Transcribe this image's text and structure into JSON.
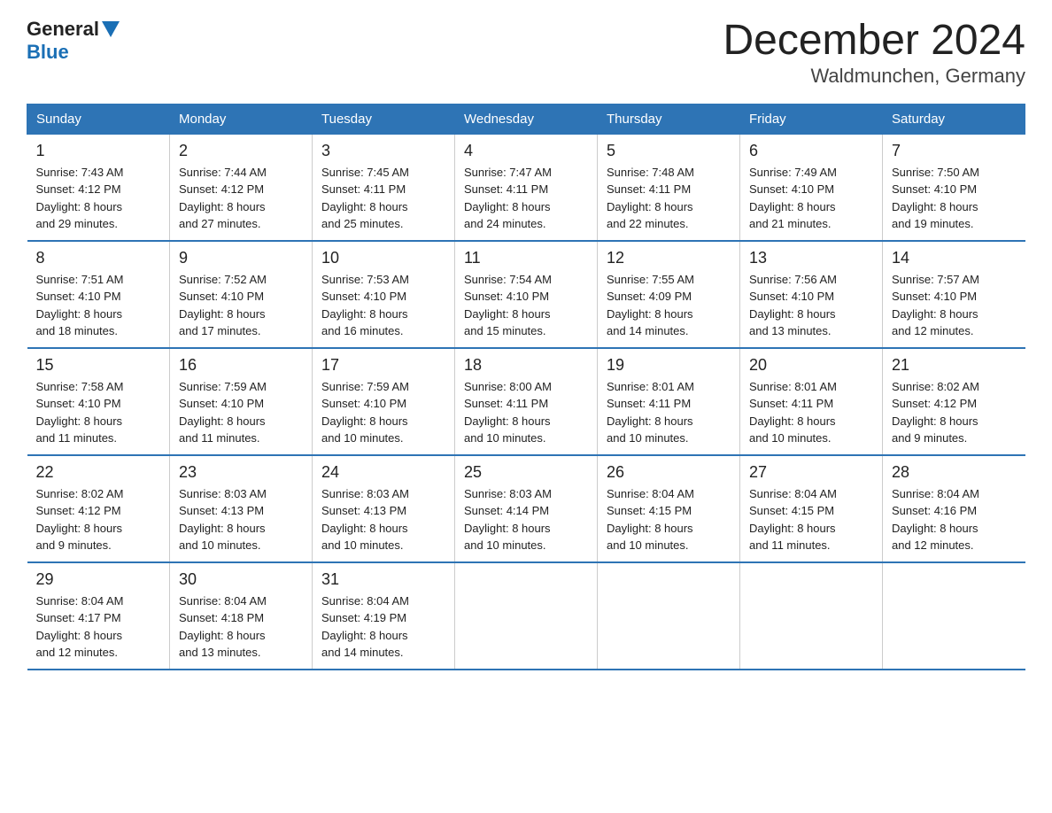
{
  "header": {
    "logo_general": "General",
    "logo_blue": "Blue",
    "title": "December 2024",
    "subtitle": "Waldmunchen, Germany"
  },
  "weekdays": [
    "Sunday",
    "Monday",
    "Tuesday",
    "Wednesday",
    "Thursday",
    "Friday",
    "Saturday"
  ],
  "weeks": [
    [
      {
        "day": "1",
        "sunrise": "7:43 AM",
        "sunset": "4:12 PM",
        "daylight": "8 hours and 29 minutes."
      },
      {
        "day": "2",
        "sunrise": "7:44 AM",
        "sunset": "4:12 PM",
        "daylight": "8 hours and 27 minutes."
      },
      {
        "day": "3",
        "sunrise": "7:45 AM",
        "sunset": "4:11 PM",
        "daylight": "8 hours and 25 minutes."
      },
      {
        "day": "4",
        "sunrise": "7:47 AM",
        "sunset": "4:11 PM",
        "daylight": "8 hours and 24 minutes."
      },
      {
        "day": "5",
        "sunrise": "7:48 AM",
        "sunset": "4:11 PM",
        "daylight": "8 hours and 22 minutes."
      },
      {
        "day": "6",
        "sunrise": "7:49 AM",
        "sunset": "4:10 PM",
        "daylight": "8 hours and 21 minutes."
      },
      {
        "day": "7",
        "sunrise": "7:50 AM",
        "sunset": "4:10 PM",
        "daylight": "8 hours and 19 minutes."
      }
    ],
    [
      {
        "day": "8",
        "sunrise": "7:51 AM",
        "sunset": "4:10 PM",
        "daylight": "8 hours and 18 minutes."
      },
      {
        "day": "9",
        "sunrise": "7:52 AM",
        "sunset": "4:10 PM",
        "daylight": "8 hours and 17 minutes."
      },
      {
        "day": "10",
        "sunrise": "7:53 AM",
        "sunset": "4:10 PM",
        "daylight": "8 hours and 16 minutes."
      },
      {
        "day": "11",
        "sunrise": "7:54 AM",
        "sunset": "4:10 PM",
        "daylight": "8 hours and 15 minutes."
      },
      {
        "day": "12",
        "sunrise": "7:55 AM",
        "sunset": "4:09 PM",
        "daylight": "8 hours and 14 minutes."
      },
      {
        "day": "13",
        "sunrise": "7:56 AM",
        "sunset": "4:10 PM",
        "daylight": "8 hours and 13 minutes."
      },
      {
        "day": "14",
        "sunrise": "7:57 AM",
        "sunset": "4:10 PM",
        "daylight": "8 hours and 12 minutes."
      }
    ],
    [
      {
        "day": "15",
        "sunrise": "7:58 AM",
        "sunset": "4:10 PM",
        "daylight": "8 hours and 11 minutes."
      },
      {
        "day": "16",
        "sunrise": "7:59 AM",
        "sunset": "4:10 PM",
        "daylight": "8 hours and 11 minutes."
      },
      {
        "day": "17",
        "sunrise": "7:59 AM",
        "sunset": "4:10 PM",
        "daylight": "8 hours and 10 minutes."
      },
      {
        "day": "18",
        "sunrise": "8:00 AM",
        "sunset": "4:11 PM",
        "daylight": "8 hours and 10 minutes."
      },
      {
        "day": "19",
        "sunrise": "8:01 AM",
        "sunset": "4:11 PM",
        "daylight": "8 hours and 10 minutes."
      },
      {
        "day": "20",
        "sunrise": "8:01 AM",
        "sunset": "4:11 PM",
        "daylight": "8 hours and 10 minutes."
      },
      {
        "day": "21",
        "sunrise": "8:02 AM",
        "sunset": "4:12 PM",
        "daylight": "8 hours and 9 minutes."
      }
    ],
    [
      {
        "day": "22",
        "sunrise": "8:02 AM",
        "sunset": "4:12 PM",
        "daylight": "8 hours and 9 minutes."
      },
      {
        "day": "23",
        "sunrise": "8:03 AM",
        "sunset": "4:13 PM",
        "daylight": "8 hours and 10 minutes."
      },
      {
        "day": "24",
        "sunrise": "8:03 AM",
        "sunset": "4:13 PM",
        "daylight": "8 hours and 10 minutes."
      },
      {
        "day": "25",
        "sunrise": "8:03 AM",
        "sunset": "4:14 PM",
        "daylight": "8 hours and 10 minutes."
      },
      {
        "day": "26",
        "sunrise": "8:04 AM",
        "sunset": "4:15 PM",
        "daylight": "8 hours and 10 minutes."
      },
      {
        "day": "27",
        "sunrise": "8:04 AM",
        "sunset": "4:15 PM",
        "daylight": "8 hours and 11 minutes."
      },
      {
        "day": "28",
        "sunrise": "8:04 AM",
        "sunset": "4:16 PM",
        "daylight": "8 hours and 12 minutes."
      }
    ],
    [
      {
        "day": "29",
        "sunrise": "8:04 AM",
        "sunset": "4:17 PM",
        "daylight": "8 hours and 12 minutes."
      },
      {
        "day": "30",
        "sunrise": "8:04 AM",
        "sunset": "4:18 PM",
        "daylight": "8 hours and 13 minutes."
      },
      {
        "day": "31",
        "sunrise": "8:04 AM",
        "sunset": "4:19 PM",
        "daylight": "8 hours and 14 minutes."
      },
      null,
      null,
      null,
      null
    ]
  ],
  "labels": {
    "sunrise": "Sunrise:",
    "sunset": "Sunset:",
    "daylight": "Daylight:"
  }
}
